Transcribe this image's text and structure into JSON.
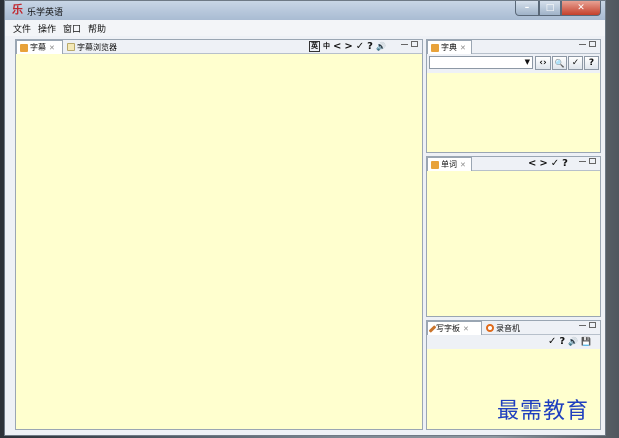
{
  "window": {
    "title": "乐学英语",
    "app_icon": "乐"
  },
  "window_controls": {
    "minimize": "–",
    "maximize": "□",
    "close": "✕"
  },
  "menu": [
    "文件",
    "操作",
    "窗口",
    "帮助"
  ],
  "subtitle_panel": {
    "tabs": [
      {
        "label": "字幕",
        "icon": "subtitle-icon",
        "closable": true,
        "active": true
      },
      {
        "label": "字幕浏览器",
        "icon": "page-icon",
        "closable": false,
        "active": false
      }
    ],
    "tools": [
      "英",
      "中",
      "<",
      ">",
      "✓",
      "?",
      "🔊"
    ]
  },
  "dictionary_panel": {
    "tab": "字典",
    "search_value": "",
    "buttons": [
      "‹›",
      "🔍",
      "✓",
      "?"
    ]
  },
  "words_panel": {
    "tab": "单词",
    "tools": [
      "<",
      ">",
      "✓",
      "?"
    ]
  },
  "writing_panel": {
    "tabs": [
      {
        "label": "写字板",
        "icon": "pencil-icon",
        "closable": true,
        "active": true
      },
      {
        "label": "录音机",
        "icon": "record-icon",
        "closable": false,
        "active": false
      }
    ],
    "tools": [
      "✓",
      "?",
      "🔊",
      "💾"
    ]
  },
  "watermark": "最需教育",
  "colors": {
    "panel_bg": "#ffffcf",
    "accent_red": "#c0262d",
    "watermark": "#1f3fbf"
  }
}
